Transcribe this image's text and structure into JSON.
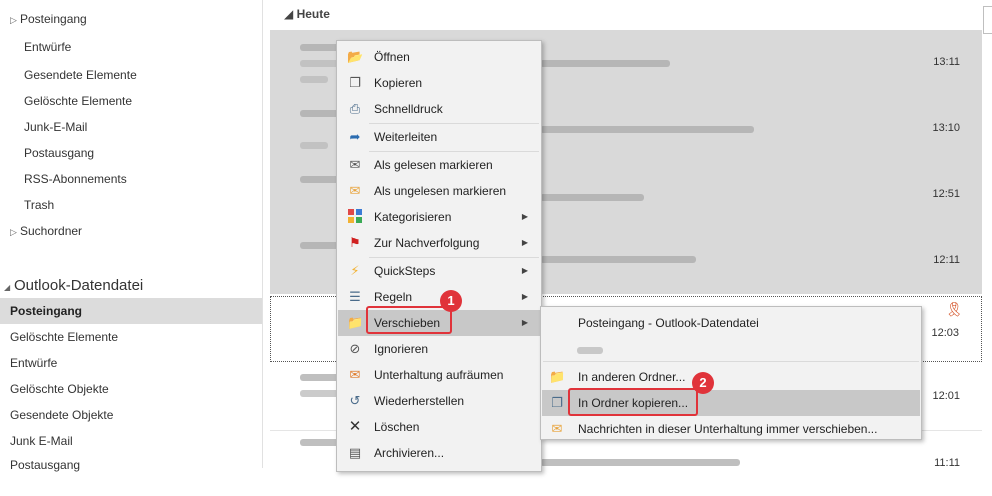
{
  "folders_top": [
    {
      "label": "Posteingang",
      "caret": "▷"
    },
    {
      "label": "Entwürfe"
    },
    {
      "label": "Gesendete Elemente"
    },
    {
      "label": "Gelöschte Elemente"
    },
    {
      "label": "Junk-E-Mail"
    },
    {
      "label": "Postausgang"
    },
    {
      "label": "RSS-Abonnements"
    },
    {
      "label": "Trash"
    },
    {
      "label": "Suchordner",
      "caret": "▷"
    }
  ],
  "datafile": {
    "header": "Outlook-Datendatei",
    "caret": "◢",
    "folders": [
      {
        "label": "Posteingang",
        "selected": true
      },
      {
        "label": "Gelöschte Elemente"
      },
      {
        "label": "Entwürfe"
      },
      {
        "label": "Gelöschte Objekte"
      },
      {
        "label": "Gesendete Objekte"
      },
      {
        "label": "Junk E-Mail"
      },
      {
        "label": "Postausgang"
      }
    ]
  },
  "message_list": {
    "group_header": "◢ Heute",
    "times": [
      "13:11",
      "13:10",
      "12:51",
      "12:11",
      "12:03",
      "12:01",
      "11:11"
    ]
  },
  "context_menu": {
    "items": [
      {
        "label": "Öffnen",
        "icon": "folder-open-icon"
      },
      {
        "label": "Kopieren",
        "icon": "copy-icon"
      },
      {
        "label": "Schnelldruck",
        "icon": "print-icon"
      },
      {
        "label": "Weiterleiten",
        "icon": "forward-icon"
      },
      {
        "label": "Als gelesen markieren",
        "icon": "envelope-open-icon"
      },
      {
        "label": "Als ungelesen markieren",
        "icon": "envelope-icon"
      },
      {
        "label": "Kategorisieren",
        "icon": "categorize-icon"
      },
      {
        "label": "Zur Nachverfolgung",
        "icon": "flag-icon"
      },
      {
        "label": "QuickSteps",
        "icon": "lightning-icon"
      },
      {
        "label": "Regeln",
        "icon": "rules-icon"
      },
      {
        "label": "Verschieben",
        "icon": "move-icon"
      },
      {
        "label": "Ignorieren",
        "icon": "ignore-icon"
      },
      {
        "label": "Unterhaltung aufräumen",
        "icon": "cleanup-icon"
      },
      {
        "label": "Wiederherstellen",
        "icon": "restore-icon"
      },
      {
        "label": "Löschen",
        "icon": "delete-icon"
      },
      {
        "label": "Archivieren...",
        "icon": "archive-icon"
      }
    ]
  },
  "submenu": {
    "items": [
      {
        "label": "Posteingang - Outlook-Datendatei"
      },
      {
        "label": "In anderen Ordner...",
        "icon": "move-folder-icon"
      },
      {
        "label": "In Ordner kopieren...",
        "icon": "copy-folder-icon"
      },
      {
        "label": "Nachrichten in dieser Unterhaltung immer verschieben...",
        "icon": "always-move-icon"
      }
    ]
  },
  "badges": {
    "one": "1",
    "two": "2"
  },
  "colors": {
    "callout": "#e0333a",
    "selected": "#dcdcdc",
    "menu_bg": "#f2f2f2"
  }
}
